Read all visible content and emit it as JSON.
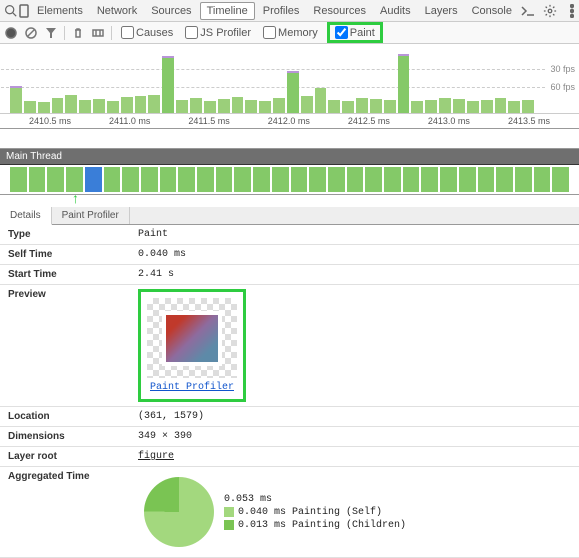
{
  "tabs": {
    "items": [
      "Elements",
      "Network",
      "Sources",
      "Timeline",
      "Profiles",
      "Resources",
      "Audits",
      "Layers",
      "Console"
    ],
    "active": "Timeline"
  },
  "toolbar": {
    "checkboxes": [
      {
        "label": "Causes",
        "checked": false
      },
      {
        "label": "JS Profiler",
        "checked": false
      },
      {
        "label": "Memory",
        "checked": false
      },
      {
        "label": "Paint",
        "checked": true
      }
    ]
  },
  "fps": {
    "line1": "30 fps",
    "line2": "60 fps"
  },
  "timeAxis": [
    "2410.5 ms",
    "2411.0 ms",
    "2411.5 ms",
    "2412.0 ms",
    "2412.5 ms",
    "2413.0 ms",
    "2413.5 ms"
  ],
  "thread": {
    "title": "Main Thread"
  },
  "detailTabs": {
    "items": [
      "Details",
      "Paint Profiler"
    ],
    "active": "Details"
  },
  "details": {
    "type_k": "Type",
    "type_v": "Paint",
    "self_k": "Self Time",
    "self_v": "0.040 ms",
    "start_k": "Start Time",
    "start_v": "2.41 s",
    "preview_k": "Preview",
    "preview_link": "Paint Profiler",
    "loc_k": "Location",
    "loc_v": "(361, 1579)",
    "dim_k": "Dimensions",
    "dim_v": "349 × 390",
    "root_k": "Layer root",
    "root_v": "figure",
    "agg_k": "Aggregated Time"
  },
  "agg": {
    "total": "0.053 ms",
    "self": "0.040 ms Painting (Self)",
    "children": "0.013 ms Painting (Children)"
  },
  "chart_data": {
    "type": "bar",
    "title": "Frame timing",
    "ylabel": "fps",
    "fps_markers": [
      30,
      60
    ],
    "x_unit": "ms",
    "x_ticks": [
      2410.5,
      2411.0,
      2411.5,
      2412.0,
      2412.5,
      2413.0,
      2413.5
    ],
    "aggregated_time": {
      "type": "pie",
      "total_ms": 0.053,
      "slices": [
        {
          "label": "Painting (Self)",
          "value_ms": 0.04
        },
        {
          "label": "Painting (Children)",
          "value_ms": 0.013
        }
      ]
    }
  }
}
